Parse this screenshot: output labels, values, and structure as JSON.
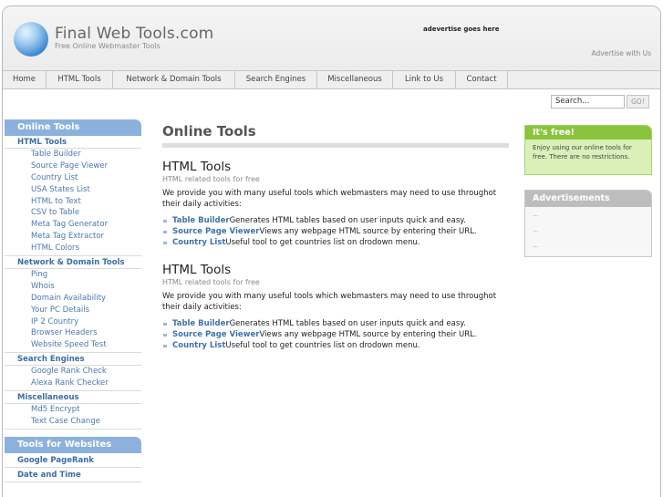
{
  "header": {
    "site_title": "Final Web Tools.com",
    "tagline": "Free Online Webmaster Tools",
    "ad_text": "adevertise goes here",
    "advertise_link": "Advertise with Us"
  },
  "nav": [
    {
      "label": "Home"
    },
    {
      "label": "HTML Tools"
    },
    {
      "label": "Network & Domain Tools"
    },
    {
      "label": "Search Engines"
    },
    {
      "label": "Miscellaneous"
    },
    {
      "label": "Link to Us"
    },
    {
      "label": "Contact"
    }
  ],
  "search": {
    "value": "Search...",
    "button_label": "GO!"
  },
  "sidebar": {
    "heading": "Online Tools",
    "categories": [
      {
        "label": "HTML Tools",
        "items": [
          "Table Builder",
          "Source Page Viewer",
          "Country List",
          "USA States List",
          "HTML to Text",
          "CSV to Table",
          "Meta Tag Generator",
          "Meta Tag Extractor",
          "HTML Colors"
        ]
      },
      {
        "label": "Network & Domain Tools",
        "items": [
          "Ping",
          "Whois",
          "Domain Availability",
          "Your PC Details",
          "IP 2 Country",
          "Browser Headers",
          "Website Speed Test"
        ]
      },
      {
        "label": "Search Engines",
        "items": [
          "Google Rank Check",
          "Alexa Rank Checker"
        ]
      },
      {
        "label": "Miscellaneous",
        "items": [
          "Md5 Encrypt",
          "Text Case Change"
        ]
      }
    ],
    "heading2": "Tools for Websites",
    "website_tools": [
      "Google PageRank",
      "Date and Time"
    ]
  },
  "main": {
    "title": "Online Tools",
    "sections": [
      {
        "title": "HTML Tools",
        "subtitle": "HTML related tools for free",
        "description": "We provide you with many useful tools which webmasters may need to use throughot their daily activities:",
        "tools": [
          {
            "name": "Table Builder",
            "desc": "Generates HTML tables based on user inputs quick and easy."
          },
          {
            "name": "Source Page Viewer",
            "desc": "Views any webpage HTML source by entering their URL."
          },
          {
            "name": "Country List",
            "desc": "Useful tool to get countries list on drodown menu."
          }
        ]
      },
      {
        "title": "HTML Tools",
        "subtitle": "HTML related tools for free",
        "description": "We provide you with many useful tools which webmasters may need to use throughot their daily activities:",
        "tools": [
          {
            "name": "Table Builder",
            "desc": "Generates HTML tables based on user inputs quick and easy."
          },
          {
            "name": "Source Page Viewer",
            "desc": "Views any webpage HTML source by entering their URL."
          },
          {
            "name": "Country List",
            "desc": "Useful tool to get countries list on drodown menu."
          }
        ]
      }
    ]
  },
  "right": {
    "free_title": "It's free!",
    "free_text": "Enjoy using our online tools for free. There are no restrictions.",
    "ads_title": "Advertisements",
    "ads_items": [
      "...",
      "...",
      "..."
    ]
  },
  "colors": {
    "accent_blue": "#8cb1dd",
    "link_blue": "#3f71ab",
    "free_green": "#8ac43a",
    "free_bg": "#d9f0b9",
    "ads_gray": "#bdbdbd"
  }
}
